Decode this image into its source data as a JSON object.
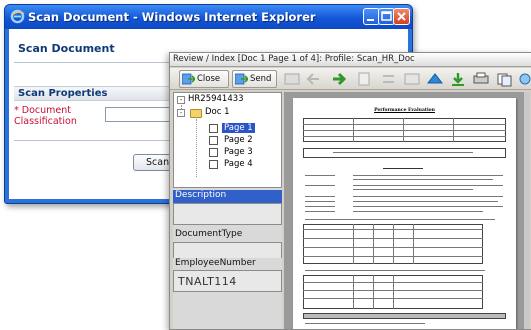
{
  "browser": {
    "title": "Scan Document - Windows Internet Explorer"
  },
  "form": {
    "heading": "Scan Document",
    "section_title": "Scan Properties",
    "required_marker": "*",
    "field_label": "Document Classification",
    "scan_button_label": "Scan Doc"
  },
  "review": {
    "title": "Review / Index [Doc 1 Page 1 of 4]: Profile: Scan_HR_Doc",
    "toolbar": {
      "close_label": "Close",
      "send_label": "Send"
    },
    "tree": {
      "root": "HR25941433",
      "doc": "Doc 1",
      "pages": [
        "Page 1",
        "Page 2",
        "Page 3",
        "Page 4"
      ],
      "selected_page": "Page 1"
    },
    "fields": {
      "description_label": "Description",
      "description_value": "",
      "doctype_label": "DocumentType",
      "doctype_value": "",
      "employee_label": "EmployeeNumber",
      "employee_value": "TNALT114"
    },
    "document": {
      "title": "Performance Evaluation"
    }
  },
  "colors": {
    "xp_title_blue": "#1356d8",
    "selection_blue": "#2a55c8",
    "required_red": "#c8102e",
    "heading_navy": "#0e3a78"
  },
  "icons": [
    "ie-logo-icon",
    "minimize-icon",
    "maximize-icon",
    "close-icon",
    "close-toolbar-icon",
    "send-icon",
    "folder-icon",
    "page-checkbox-icon"
  ]
}
